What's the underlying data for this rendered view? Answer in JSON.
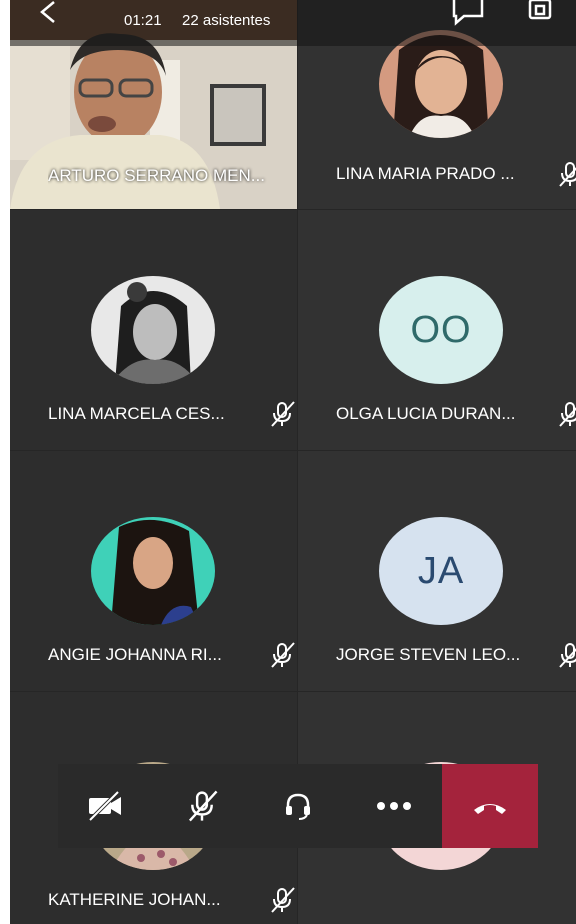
{
  "header": {
    "call_time": "01:21",
    "attendees": "22 asistentes"
  },
  "participants": [
    {
      "name": "ARTURO SERRANO MEN...",
      "type": "video"
    },
    {
      "name": "LINA MARIA PRADO ...",
      "type": "photo"
    },
    {
      "name": "LINA MARCELA CES...",
      "type": "photo"
    },
    {
      "name": "OLGA LUCIA DURAN...",
      "type": "initials",
      "initials": "OO",
      "avatar_bg": "#d7efed",
      "avatar_fg": "#2f6a6a"
    },
    {
      "name": "ANGIE JOHANNA RI...",
      "type": "photo"
    },
    {
      "name": "JORGE STEVEN LEO...",
      "type": "initials",
      "initials": "JA",
      "avatar_bg": "#d6e2ef",
      "avatar_fg": "#2a4a70"
    },
    {
      "name": "KATHERINE JOHAN...",
      "type": "photo"
    }
  ],
  "controls": [
    "camera-off",
    "mic-off",
    "audio",
    "more",
    "hang-up"
  ],
  "colors": {
    "background": "#262626",
    "hangup": "#a4233c"
  }
}
